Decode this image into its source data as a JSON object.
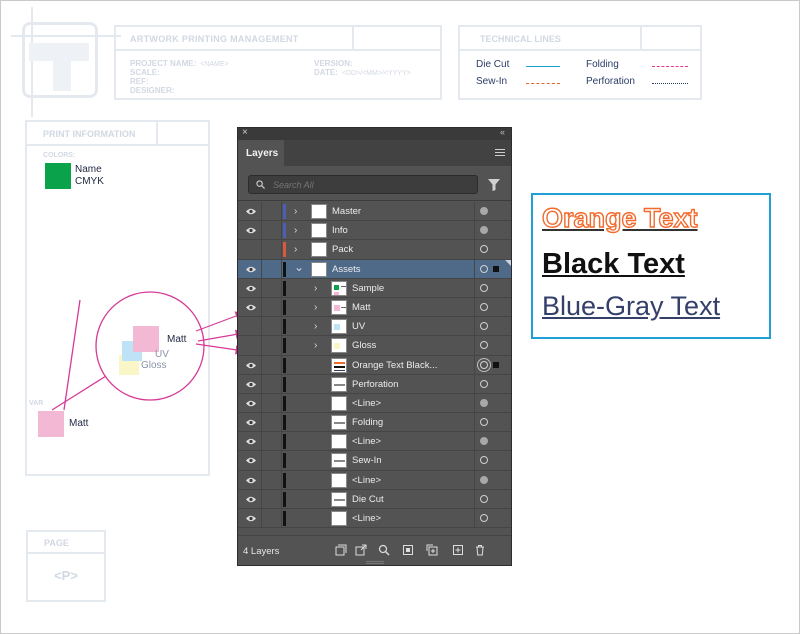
{
  "template": {
    "title_header": "ARTWORK PRINTING MANAGEMENT",
    "project_name_label": "PROJECT NAME:",
    "project_name_placeholder": "<NAME>",
    "scale_label": "SCALE:",
    "ref_label": "REF:",
    "designer_label": "DESIGNER:",
    "version_label": "VERSION:",
    "date_label": "DATE:",
    "date_placeholder": "<DD>/<MM>/<YYYY>",
    "technical_header": "TECHNICAL LINES",
    "tech_lines": [
      {
        "label": "Die Cut",
        "color": "#1e9fd8",
        "style": "solid"
      },
      {
        "label": "Sew-In",
        "color": "#e8642c",
        "style": "dashdot"
      },
      {
        "label": "Folding",
        "color": "#e8368f",
        "style": "dashed"
      },
      {
        "label": "Perforation",
        "color": "#2a3c66",
        "style": "dotted"
      }
    ],
    "print_header": "PRINT INFORMATION",
    "colors_label": "COLORS:",
    "swatch_name": "Name",
    "swatch_mode": "CMYK",
    "varnish_label": "VAR",
    "varnish_name": "Matt",
    "page_header": "PAGE",
    "page_value": "<P>"
  },
  "callout": {
    "matt": "Matt",
    "uv": "UV",
    "gloss": "Gloss"
  },
  "layers_panel": {
    "tab_label": "Layers",
    "search_placeholder": "Search All",
    "layer_count": "4 Layers",
    "rows": [
      {
        "label": "Master",
        "visible": true,
        "chevron": "right",
        "indent": 0,
        "bar": "#4a5fb4",
        "target": "filled"
      },
      {
        "label": "Info",
        "visible": true,
        "chevron": "right",
        "indent": 0,
        "bar": "#4a5fb4",
        "target": "filled"
      },
      {
        "label": "Pack",
        "visible": false,
        "chevron": "right",
        "indent": 0,
        "bar": "#d95a3a",
        "target": "empty"
      },
      {
        "label": "Assets",
        "visible": true,
        "chevron": "down",
        "indent": 0,
        "bar": "#111111",
        "target": "empty",
        "selected": true
      },
      {
        "label": "Sample",
        "visible": true,
        "chevron": "right",
        "indent": 1,
        "bar": "#111111",
        "target": "empty",
        "thumb": "sample"
      },
      {
        "label": "Matt",
        "visible": true,
        "chevron": "right",
        "indent": 1,
        "bar": "#111111",
        "target": "empty",
        "thumb": "matt"
      },
      {
        "label": "UV",
        "visible": false,
        "chevron": "right",
        "indent": 1,
        "bar": "#111111",
        "target": "empty",
        "thumb": "uv"
      },
      {
        "label": "Gloss",
        "visible": false,
        "chevron": "right",
        "indent": 1,
        "bar": "#111111",
        "target": "empty",
        "thumb": "gloss"
      },
      {
        "label": "Orange Text Black...",
        "visible": true,
        "chevron": "",
        "indent": 1,
        "bar": "#111111",
        "target": "double",
        "thumb": "text"
      },
      {
        "label": "Perforation",
        "visible": true,
        "chevron": "",
        "indent": 1,
        "bar": "#111111",
        "target": "empty",
        "thumb": "line"
      },
      {
        "label": "<Line>",
        "visible": true,
        "chevron": "",
        "indent": 1,
        "bar": "#111111",
        "target": "filled",
        "thumb": "blank"
      },
      {
        "label": "Folding",
        "visible": true,
        "chevron": "",
        "indent": 1,
        "bar": "#111111",
        "target": "empty",
        "thumb": "line"
      },
      {
        "label": "<Line>",
        "visible": true,
        "chevron": "",
        "indent": 1,
        "bar": "#111111",
        "target": "filled",
        "thumb": "blank"
      },
      {
        "label": "Sew-In",
        "visible": true,
        "chevron": "",
        "indent": 1,
        "bar": "#111111",
        "target": "empty",
        "thumb": "line"
      },
      {
        "label": "<Line>",
        "visible": true,
        "chevron": "",
        "indent": 1,
        "bar": "#111111",
        "target": "filled",
        "thumb": "blank"
      },
      {
        "label": "Die Cut",
        "visible": true,
        "chevron": "",
        "indent": 1,
        "bar": "#111111",
        "target": "empty",
        "thumb": "line"
      },
      {
        "label": "<Line>",
        "visible": true,
        "chevron": "",
        "indent": 1,
        "bar": "#111111",
        "target": "empty",
        "thumb": "blank"
      }
    ]
  },
  "text_styles": {
    "orange": "Orange Text",
    "black": "Black Text",
    "blue": "Blue-Gray Text",
    "box_color": "#1e9fd8"
  }
}
